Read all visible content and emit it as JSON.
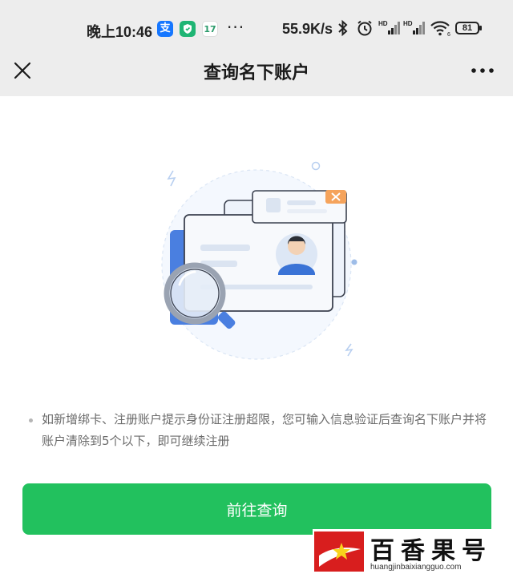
{
  "status_bar": {
    "time": "晚上10:46",
    "apps": [
      {
        "icon": "alipay-icon",
        "glyph": "支",
        "color": "#1677ff"
      },
      {
        "icon": "shield-app-icon",
        "glyph": "",
        "color": "#1fb574"
      },
      {
        "icon": "calendar-icon",
        "glyph": "17",
        "color": "#ffffff"
      }
    ],
    "more_dots": "···",
    "network_speed": "55.9K/s",
    "signal_tags": [
      "HD",
      "HD"
    ],
    "wifi_tag": "6",
    "battery": "81"
  },
  "nav": {
    "title": "查询名下账户",
    "close_icon": "close-icon",
    "more_icon": "more-icon"
  },
  "illustration": {
    "name": "id-card-search-illustration",
    "colors": {
      "accent": "#4a7fe0",
      "badge": "#f5a35b",
      "avatar": "#3a73d6"
    }
  },
  "notice": {
    "text": "如新增绑卡、注册账户提示身份证注册超限，您可输入信息验证后查询名下账户并将账户清除到5个以下，即可继续注册"
  },
  "primary_button": {
    "label": "前往查询",
    "color": "#22c15e"
  },
  "watermark": {
    "name": "百香果号",
    "url": "huangjinbaixiangguo.com"
  }
}
